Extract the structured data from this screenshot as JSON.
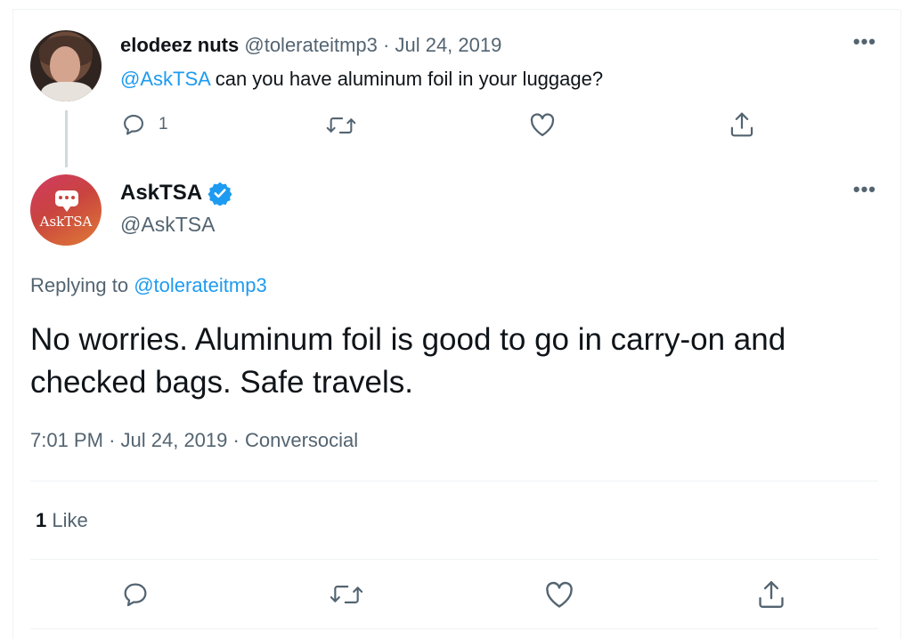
{
  "parent_tweet": {
    "name": "elodeez nuts",
    "handle": "@tolerateitmp3",
    "separator": "·",
    "date": "Jul 24, 2019",
    "mention": "@AskTSA",
    "text": " can you have aluminum foil in your luggage?",
    "reply_count": "1",
    "more": "•••"
  },
  "main_tweet": {
    "name": "AskTSA",
    "handle": "@AskTSA",
    "avatar_label": "AskTSA",
    "replying_prefix": "Replying to ",
    "replying_handle": "@tolerateitmp3",
    "text": "No worries. Aluminum foil is good to go in carry-on and checked bags. Safe travels.",
    "time": "7:01 PM",
    "date": "Jul 24, 2019",
    "source": "Conversocial",
    "separator": "·",
    "likes_count": "1",
    "likes_label": "Like",
    "more": "•••"
  },
  "icons": {
    "reply": "reply-icon",
    "retweet": "retweet-icon",
    "like": "heart-icon",
    "share": "share-icon",
    "verified": "verified-badge-icon",
    "more": "more-icon"
  },
  "colors": {
    "link": "#1d9bf0",
    "secondary_text": "#536471",
    "primary_text": "#0f1419",
    "verified": "#1d9bf0"
  }
}
